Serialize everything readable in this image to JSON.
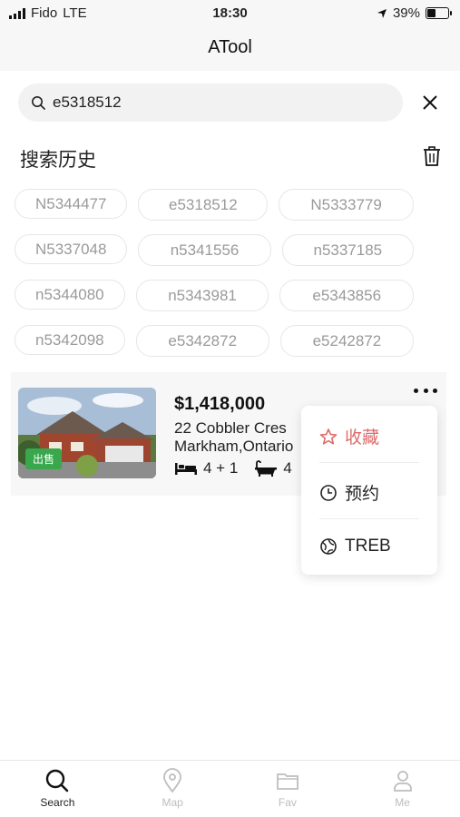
{
  "status": {
    "carrier": "Fido",
    "network": "LTE",
    "time": "18:30",
    "battery": "39%"
  },
  "header": {
    "title": "ATool"
  },
  "search": {
    "value": "e5318512"
  },
  "history": {
    "title": "搜索历史",
    "rows": [
      [
        "N5344477",
        "e5318512",
        "N5333779"
      ],
      [
        "N5337048",
        "n5341556",
        "n5337185"
      ],
      [
        "n5344080",
        "n5343981",
        "e5343856"
      ],
      [
        "n5342098",
        "e5342872",
        "e5242872"
      ]
    ]
  },
  "listing": {
    "badge": "出售",
    "price": "$1,418,000",
    "address_line1": "22 Cobbler Cres",
    "address_line2": "Markham,Ontario",
    "beds": "4 + 1",
    "baths": "4"
  },
  "menu": {
    "favorite": "收藏",
    "appointment": "预约",
    "treb": "TREB"
  },
  "tabs": [
    {
      "label": "Search",
      "active": true
    },
    {
      "label": "Map",
      "active": false
    },
    {
      "label": "Fav",
      "active": false
    },
    {
      "label": "Me",
      "active": false
    }
  ],
  "colors": {
    "accent_red": "#e06a6a",
    "sale_green": "#39a84d",
    "chip_text": "#9a9a9a"
  }
}
